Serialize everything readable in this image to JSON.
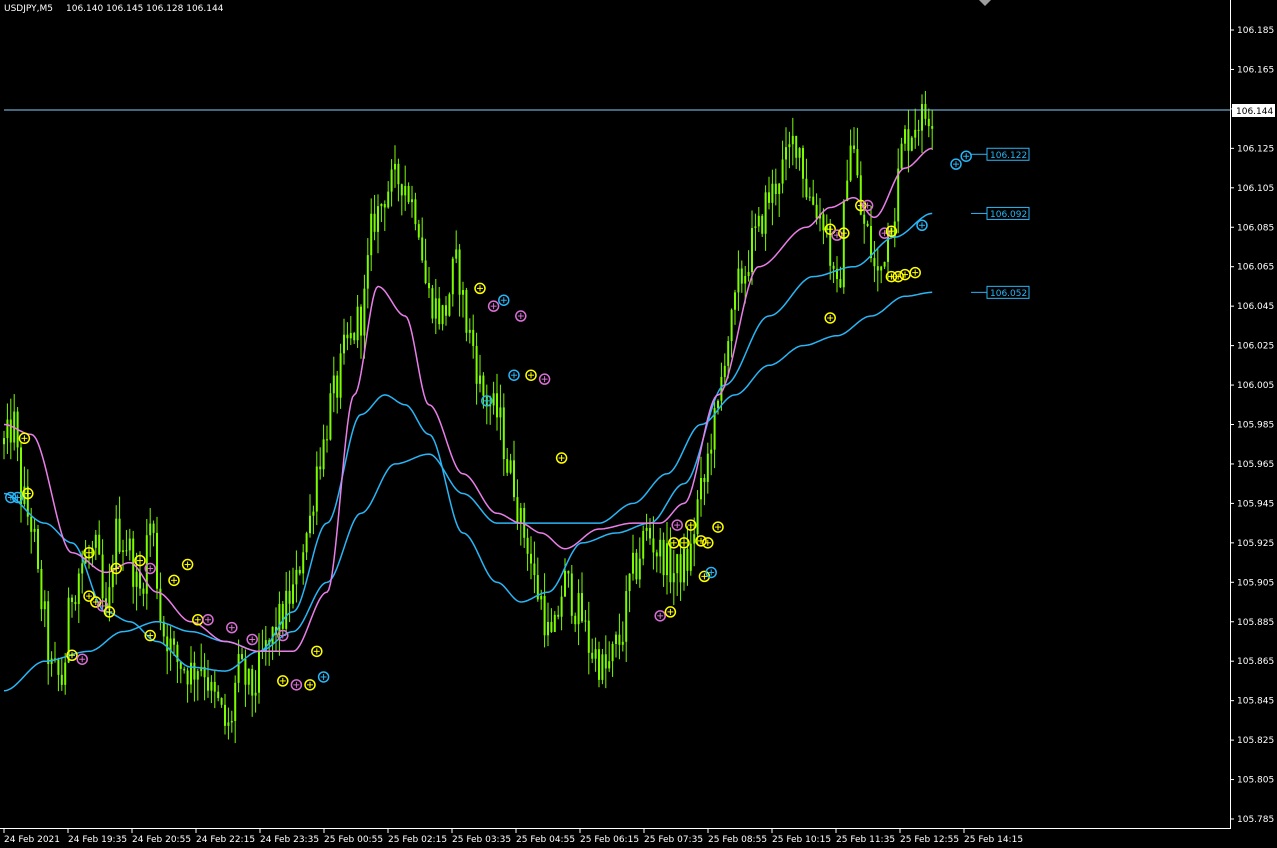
{
  "header": {
    "symbol": "USDJPY,M5",
    "quote": "106.140 106.145 106.128 106.144"
  },
  "colors": {
    "background": "#000000",
    "candle": "#7CFC00",
    "ma_fast": "#E87FE8",
    "ma_slow": "#29B6F6",
    "marker_yellow": "#FFFF00",
    "marker_pink": "#DA70D6",
    "marker_blue": "#29B6F6",
    "axis": "#FFFFFF",
    "current_price_line": "#87CEFA"
  },
  "chart_data": {
    "type": "candlestick",
    "instrument": "USDJPY",
    "timeframe": "M5",
    "y_ticks": [
      "106.185",
      "106.165",
      "106.145",
      "106.125",
      "106.105",
      "106.085",
      "106.065",
      "106.045",
      "106.025",
      "106.005",
      "105.985",
      "105.965",
      "105.945",
      "105.925",
      "105.905",
      "105.885",
      "105.865",
      "105.845",
      "105.825",
      "105.805",
      "105.785"
    ],
    "ylim": [
      105.782,
      106.194
    ],
    "x_labels": [
      "24 Feb 2021",
      "24 Feb 19:35",
      "24 Feb 20:55",
      "24 Feb 22:15",
      "24 Feb 23:35",
      "25 Feb 00:55",
      "25 Feb 02:15",
      "25 Feb 03:35",
      "25 Feb 04:55",
      "25 Feb 06:15",
      "25 Feb 07:35",
      "25 Feb 08:55",
      "25 Feb 10:15",
      "25 Feb 11:35",
      "25 Feb 12:55",
      "25 Feb 14:15"
    ],
    "current_price": "106.144",
    "ma_levels": [
      {
        "label": "106.122",
        "value": 106.122
      },
      {
        "label": "106.092",
        "value": 106.092
      },
      {
        "label": "106.052",
        "value": 106.052
      }
    ],
    "close_anchors": [
      {
        "bar": 0,
        "price": 105.975
      },
      {
        "bar": 3,
        "price": 105.985
      },
      {
        "bar": 5,
        "price": 105.95
      },
      {
        "bar": 8,
        "price": 105.935
      },
      {
        "bar": 11,
        "price": 105.895
      },
      {
        "bar": 14,
        "price": 105.86
      },
      {
        "bar": 17,
        "price": 105.855
      },
      {
        "bar": 20,
        "price": 105.9
      },
      {
        "bar": 23,
        "price": 105.915
      },
      {
        "bar": 27,
        "price": 105.92
      },
      {
        "bar": 30,
        "price": 105.885
      },
      {
        "bar": 33,
        "price": 105.93
      },
      {
        "bar": 36,
        "price": 105.925
      },
      {
        "bar": 40,
        "price": 105.9
      },
      {
        "bar": 43,
        "price": 105.935
      },
      {
        "bar": 47,
        "price": 105.88
      },
      {
        "bar": 51,
        "price": 105.865
      },
      {
        "bar": 55,
        "price": 105.86
      },
      {
        "bar": 58,
        "price": 105.865
      },
      {
        "bar": 62,
        "price": 105.845
      },
      {
        "bar": 66,
        "price": 105.83
      },
      {
        "bar": 69,
        "price": 105.86
      },
      {
        "bar": 73,
        "price": 105.85
      },
      {
        "bar": 77,
        "price": 105.87
      },
      {
        "bar": 81,
        "price": 105.885
      },
      {
        "bar": 85,
        "price": 105.9
      },
      {
        "bar": 89,
        "price": 105.93
      },
      {
        "bar": 93,
        "price": 105.97
      },
      {
        "bar": 97,
        "price": 106.0
      },
      {
        "bar": 101,
        "price": 106.025
      },
      {
        "bar": 105,
        "price": 106.04
      },
      {
        "bar": 109,
        "price": 106.09
      },
      {
        "bar": 113,
        "price": 106.105
      },
      {
        "bar": 117,
        "price": 106.11
      },
      {
        "bar": 121,
        "price": 106.095
      },
      {
        "bar": 125,
        "price": 106.05
      },
      {
        "bar": 129,
        "price": 106.04
      },
      {
        "bar": 133,
        "price": 106.065
      },
      {
        "bar": 137,
        "price": 106.03
      },
      {
        "bar": 141,
        "price": 106.0
      },
      {
        "bar": 145,
        "price": 105.99
      },
      {
        "bar": 149,
        "price": 105.96
      },
      {
        "bar": 153,
        "price": 105.93
      },
      {
        "bar": 157,
        "price": 105.9
      },
      {
        "bar": 161,
        "price": 105.875
      },
      {
        "bar": 165,
        "price": 105.905
      },
      {
        "bar": 169,
        "price": 105.89
      },
      {
        "bar": 173,
        "price": 105.87
      },
      {
        "bar": 177,
        "price": 105.86
      },
      {
        "bar": 181,
        "price": 105.875
      },
      {
        "bar": 185,
        "price": 105.91
      },
      {
        "bar": 189,
        "price": 105.93
      },
      {
        "bar": 193,
        "price": 105.92
      },
      {
        "bar": 197,
        "price": 105.91
      },
      {
        "bar": 201,
        "price": 105.915
      },
      {
        "bar": 205,
        "price": 105.95
      },
      {
        "bar": 209,
        "price": 105.985
      },
      {
        "bar": 213,
        "price": 106.03
      },
      {
        "bar": 217,
        "price": 106.06
      },
      {
        "bar": 221,
        "price": 106.08
      },
      {
        "bar": 225,
        "price": 106.1
      },
      {
        "bar": 229,
        "price": 106.115
      },
      {
        "bar": 233,
        "price": 106.13
      },
      {
        "bar": 237,
        "price": 106.1
      },
      {
        "bar": 241,
        "price": 106.09
      },
      {
        "bar": 245,
        "price": 106.05
      },
      {
        "bar": 249,
        "price": 106.13
      },
      {
        "bar": 253,
        "price": 106.085
      },
      {
        "bar": 257,
        "price": 106.06
      },
      {
        "bar": 261,
        "price": 106.09
      },
      {
        "bar": 265,
        "price": 106.13
      },
      {
        "bar": 269,
        "price": 106.14
      },
      {
        "bar": 273,
        "price": 106.144
      }
    ],
    "ma_fast_points": [
      {
        "bar": 0,
        "price": 105.985
      },
      {
        "bar": 8,
        "price": 105.98
      },
      {
        "bar": 20,
        "price": 105.92
      },
      {
        "bar": 30,
        "price": 105.91
      },
      {
        "bar": 37,
        "price": 105.915
      },
      {
        "bar": 45,
        "price": 105.9
      },
      {
        "bar": 55,
        "price": 105.885
      },
      {
        "bar": 65,
        "price": 105.875
      },
      {
        "bar": 75,
        "price": 105.87
      },
      {
        "bar": 85,
        "price": 105.87
      },
      {
        "bar": 95,
        "price": 105.9
      },
      {
        "bar": 103,
        "price": 106.0
      },
      {
        "bar": 110,
        "price": 106.055
      },
      {
        "bar": 118,
        "price": 106.04
      },
      {
        "bar": 125,
        "price": 105.995
      },
      {
        "bar": 135,
        "price": 105.96
      },
      {
        "bar": 145,
        "price": 105.94
      },
      {
        "bar": 152,
        "price": 105.935
      },
      {
        "bar": 158,
        "price": 105.93
      },
      {
        "bar": 165,
        "price": 105.922
      },
      {
        "bar": 175,
        "price": 105.932
      },
      {
        "bar": 185,
        "price": 105.935
      },
      {
        "bar": 193,
        "price": 105.935
      },
      {
        "bar": 200,
        "price": 105.945
      },
      {
        "bar": 210,
        "price": 106.0
      },
      {
        "bar": 222,
        "price": 106.065
      },
      {
        "bar": 236,
        "price": 106.085
      },
      {
        "bar": 243,
        "price": 106.095
      },
      {
        "bar": 250,
        "price": 106.1
      },
      {
        "bar": 256,
        "price": 106.09
      },
      {
        "bar": 265,
        "price": 106.115
      },
      {
        "bar": 273,
        "price": 106.125
      }
    ],
    "ma_mid_points": [
      {
        "bar": 0,
        "price": 105.95
      },
      {
        "bar": 12,
        "price": 105.935
      },
      {
        "bar": 20,
        "price": 105.925
      },
      {
        "bar": 30,
        "price": 105.89
      },
      {
        "bar": 37,
        "price": 105.885
      },
      {
        "bar": 45,
        "price": 105.875
      },
      {
        "bar": 55,
        "price": 105.862
      },
      {
        "bar": 65,
        "price": 105.86
      },
      {
        "bar": 75,
        "price": 105.87
      },
      {
        "bar": 85,
        "price": 105.89
      },
      {
        "bar": 95,
        "price": 105.935
      },
      {
        "bar": 105,
        "price": 105.99
      },
      {
        "bar": 112,
        "price": 106.0
      },
      {
        "bar": 118,
        "price": 105.995
      },
      {
        "bar": 125,
        "price": 105.98
      },
      {
        "bar": 135,
        "price": 105.93
      },
      {
        "bar": 145,
        "price": 105.905
      },
      {
        "bar": 152,
        "price": 105.895
      },
      {
        "bar": 160,
        "price": 105.9
      },
      {
        "bar": 170,
        "price": 105.925
      },
      {
        "bar": 180,
        "price": 105.93
      },
      {
        "bar": 190,
        "price": 105.935
      },
      {
        "bar": 200,
        "price": 105.955
      },
      {
        "bar": 212,
        "price": 106.005
      },
      {
        "bar": 225,
        "price": 106.04
      },
      {
        "bar": 238,
        "price": 106.06
      },
      {
        "bar": 250,
        "price": 106.065
      },
      {
        "bar": 262,
        "price": 106.08
      },
      {
        "bar": 273,
        "price": 106.092
      }
    ],
    "ma_slow_points": [
      {
        "bar": 0,
        "price": 105.85
      },
      {
        "bar": 12,
        "price": 105.865
      },
      {
        "bar": 25,
        "price": 105.87
      },
      {
        "bar": 35,
        "price": 105.88
      },
      {
        "bar": 45,
        "price": 105.885
      },
      {
        "bar": 55,
        "price": 105.88
      },
      {
        "bar": 65,
        "price": 105.875
      },
      {
        "bar": 75,
        "price": 105.87
      },
      {
        "bar": 85,
        "price": 105.88
      },
      {
        "bar": 95,
        "price": 105.905
      },
      {
        "bar": 105,
        "price": 105.94
      },
      {
        "bar": 115,
        "price": 105.965
      },
      {
        "bar": 125,
        "price": 105.97
      },
      {
        "bar": 135,
        "price": 105.95
      },
      {
        "bar": 145,
        "price": 105.935
      },
      {
        "bar": 155,
        "price": 105.935
      },
      {
        "bar": 165,
        "price": 105.935
      },
      {
        "bar": 175,
        "price": 105.935
      },
      {
        "bar": 185,
        "price": 105.945
      },
      {
        "bar": 195,
        "price": 105.96
      },
      {
        "bar": 205,
        "price": 105.985
      },
      {
        "bar": 215,
        "price": 106.0
      },
      {
        "bar": 225,
        "price": 106.015
      },
      {
        "bar": 235,
        "price": 106.025
      },
      {
        "bar": 245,
        "price": 106.03
      },
      {
        "bar": 255,
        "price": 106.04
      },
      {
        "bar": 265,
        "price": 106.05
      },
      {
        "bar": 273,
        "price": 106.052
      }
    ],
    "markers": [
      {
        "bar": 2,
        "price": 105.948,
        "color": "blue"
      },
      {
        "bar": 4,
        "price": 105.948,
        "color": "blue"
      },
      {
        "bar": 6,
        "price": 105.978,
        "color": "yellow"
      },
      {
        "bar": 7,
        "price": 105.95,
        "color": "yellow"
      },
      {
        "bar": 20,
        "price": 105.868,
        "color": "yellow"
      },
      {
        "bar": 23,
        "price": 105.866,
        "color": "pink"
      },
      {
        "bar": 25,
        "price": 105.92,
        "color": "yellow"
      },
      {
        "bar": 25,
        "price": 105.898,
        "color": "yellow"
      },
      {
        "bar": 27,
        "price": 105.895,
        "color": "yellow"
      },
      {
        "bar": 29,
        "price": 105.893,
        "color": "pink"
      },
      {
        "bar": 31,
        "price": 105.89,
        "color": "yellow"
      },
      {
        "bar": 33,
        "price": 105.912,
        "color": "yellow"
      },
      {
        "bar": 40,
        "price": 105.916,
        "color": "yellow"
      },
      {
        "bar": 43,
        "price": 105.912,
        "color": "pink"
      },
      {
        "bar": 43,
        "price": 105.878,
        "color": "yellow"
      },
      {
        "bar": 50,
        "price": 105.906,
        "color": "yellow"
      },
      {
        "bar": 54,
        "price": 105.914,
        "color": "yellow"
      },
      {
        "bar": 57,
        "price": 105.886,
        "color": "yellow"
      },
      {
        "bar": 60,
        "price": 105.886,
        "color": "pink"
      },
      {
        "bar": 67,
        "price": 105.882,
        "color": "pink"
      },
      {
        "bar": 73,
        "price": 105.876,
        "color": "pink"
      },
      {
        "bar": 82,
        "price": 105.878,
        "color": "pink"
      },
      {
        "bar": 82,
        "price": 105.855,
        "color": "yellow"
      },
      {
        "bar": 86,
        "price": 105.853,
        "color": "pink"
      },
      {
        "bar": 90,
        "price": 105.853,
        "color": "yellow"
      },
      {
        "bar": 92,
        "price": 105.87,
        "color": "yellow"
      },
      {
        "bar": 94,
        "price": 105.857,
        "color": "blue"
      },
      {
        "bar": 140,
        "price": 106.054,
        "color": "yellow"
      },
      {
        "bar": 144,
        "price": 106.045,
        "color": "pink"
      },
      {
        "bar": 147,
        "price": 106.048,
        "color": "blue"
      },
      {
        "bar": 142,
        "price": 105.997,
        "color": "blue"
      },
      {
        "bar": 150,
        "price": 106.01,
        "color": "blue"
      },
      {
        "bar": 155,
        "price": 106.01,
        "color": "yellow"
      },
      {
        "bar": 159,
        "price": 106.008,
        "color": "pink"
      },
      {
        "bar": 152,
        "price": 106.04,
        "color": "pink"
      },
      {
        "bar": 164,
        "price": 105.968,
        "color": "yellow"
      },
      {
        "bar": 193,
        "price": 105.888,
        "color": "pink"
      },
      {
        "bar": 196,
        "price": 105.89,
        "color": "yellow"
      },
      {
        "bar": 197,
        "price": 105.925,
        "color": "yellow"
      },
      {
        "bar": 200,
        "price": 105.925,
        "color": "yellow"
      },
      {
        "bar": 198,
        "price": 105.934,
        "color": "pink"
      },
      {
        "bar": 202,
        "price": 105.934,
        "color": "yellow"
      },
      {
        "bar": 205,
        "price": 105.926,
        "color": "yellow"
      },
      {
        "bar": 207,
        "price": 105.925,
        "color": "yellow"
      },
      {
        "bar": 206,
        "price": 105.908,
        "color": "yellow"
      },
      {
        "bar": 208,
        "price": 105.91,
        "color": "blue"
      },
      {
        "bar": 210,
        "price": 105.933,
        "color": "yellow"
      },
      {
        "bar": 243,
        "price": 106.084,
        "color": "yellow"
      },
      {
        "bar": 245,
        "price": 106.081,
        "color": "pink"
      },
      {
        "bar": 247,
        "price": 106.082,
        "color": "yellow"
      },
      {
        "bar": 243,
        "price": 106.039,
        "color": "yellow"
      },
      {
        "bar": 252,
        "price": 106.096,
        "color": "yellow"
      },
      {
        "bar": 254,
        "price": 106.096,
        "color": "pink"
      },
      {
        "bar": 259,
        "price": 106.082,
        "color": "pink"
      },
      {
        "bar": 261,
        "price": 106.083,
        "color": "yellow"
      },
      {
        "bar": 261,
        "price": 106.06,
        "color": "yellow"
      },
      {
        "bar": 263,
        "price": 106.06,
        "color": "yellow"
      },
      {
        "bar": 265,
        "price": 106.061,
        "color": "yellow"
      },
      {
        "bar": 268,
        "price": 106.062,
        "color": "yellow"
      },
      {
        "bar": 270,
        "price": 106.086,
        "color": "blue"
      },
      {
        "bar": 280,
        "price": 106.117,
        "color": "blue"
      },
      {
        "bar": 283,
        "price": 106.121,
        "color": "blue"
      }
    ]
  }
}
